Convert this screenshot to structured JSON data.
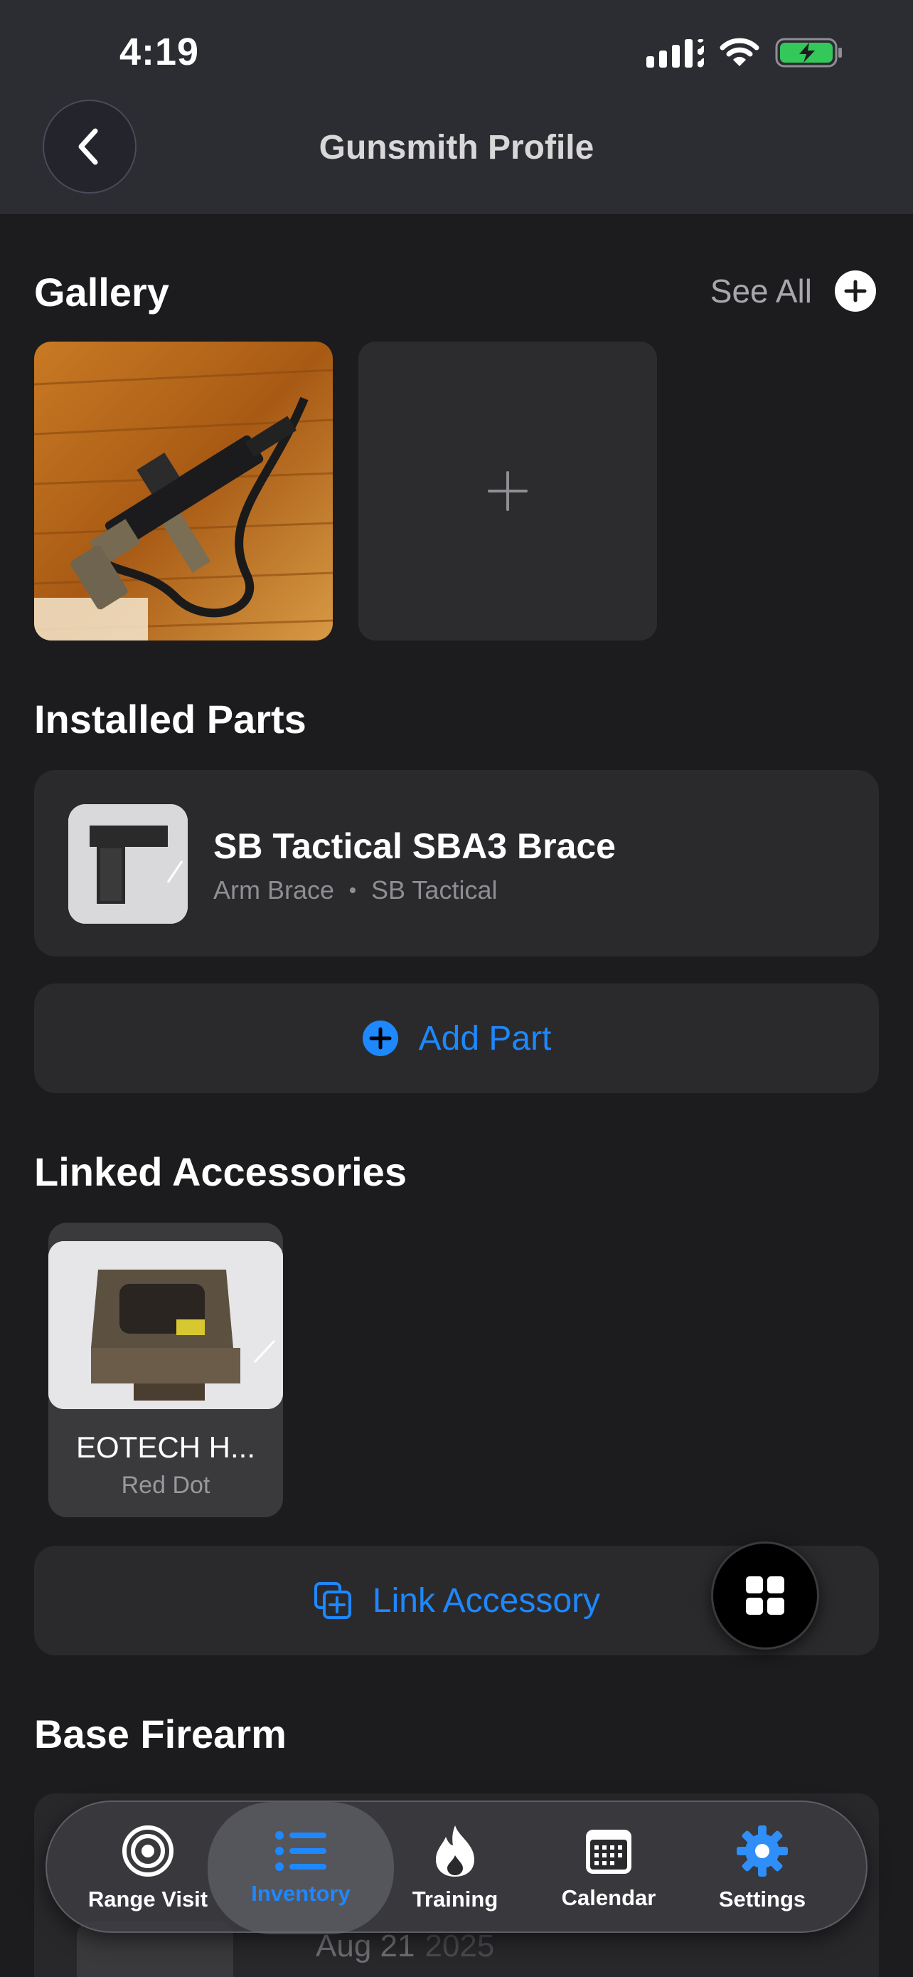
{
  "status_bar": {
    "time": "4:19"
  },
  "header": {
    "title": "Gunsmith Profile"
  },
  "gallery": {
    "title": "Gallery",
    "see_all_label": "See All"
  },
  "installed_parts": {
    "title": "Installed Parts",
    "items": [
      {
        "name": "SB Tactical SBA3 Brace",
        "category": "Arm Brace",
        "brand": "SB Tactical"
      }
    ],
    "add_label": "Add Part"
  },
  "linked_accessories": {
    "title": "Linked Accessories",
    "items": [
      {
        "name": "EOTECH H...",
        "type": "Red Dot"
      }
    ],
    "link_label": "Link Accessory"
  },
  "base_firearm": {
    "title": "Base Firearm",
    "date": "Aug 21",
    "year": "2025"
  },
  "tabbar": {
    "items": [
      {
        "label": "Range Visit",
        "icon": "target-icon"
      },
      {
        "label": "Inventory",
        "icon": "list-icon",
        "active": true
      },
      {
        "label": "Training",
        "icon": "flame-icon"
      },
      {
        "label": "Calendar",
        "icon": "calendar-icon"
      },
      {
        "label": "Settings",
        "icon": "gear-icon"
      }
    ]
  },
  "colors": {
    "accent": "#1e88ff",
    "background": "#1c1c1e",
    "card": "#2a2a2d",
    "battery": "#34c759"
  }
}
